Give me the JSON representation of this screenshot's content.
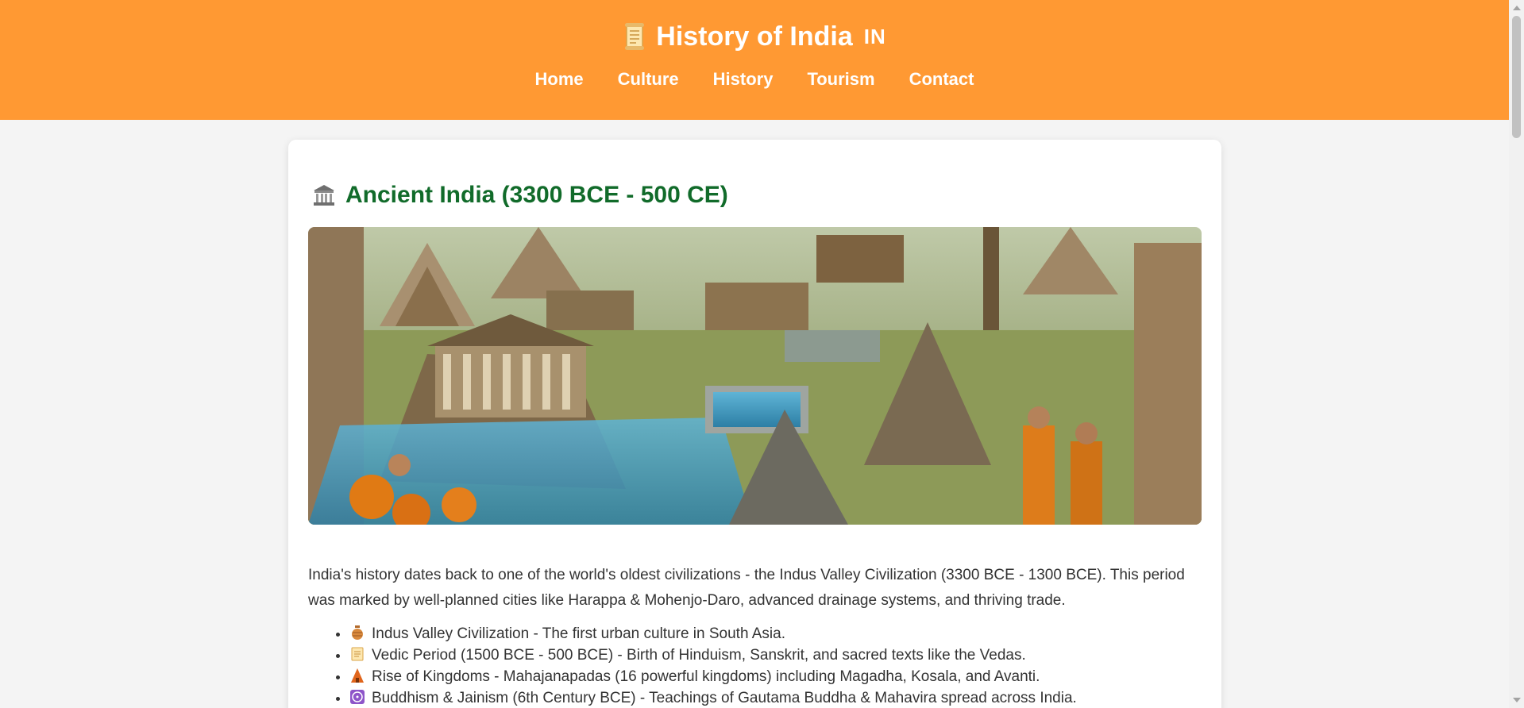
{
  "header": {
    "title": "History of India",
    "flag_code": "IN",
    "icons": {
      "title": "scroll-icon"
    },
    "brand_color": "#ff9933",
    "nav": [
      {
        "label": "Home"
      },
      {
        "label": "Culture"
      },
      {
        "label": "History"
      },
      {
        "label": "Tourism"
      },
      {
        "label": "Contact"
      }
    ]
  },
  "main": {
    "section_title": "Ancient India (3300 BCE - 500 CE)",
    "section_icon": "classical-building-icon",
    "title_color": "#116b2a",
    "hero_image": "ancient-india-illustration",
    "intro": "India's history dates back to one of the world's oldest civilizations - the Indus Valley Civilization (3300 BCE - 1300 BCE). This period was marked by well-planned cities like Harappa & Mohenjo-Daro, advanced drainage systems, and thriving trade.",
    "events": [
      {
        "icon": "amphora-icon",
        "text": "Indus Valley Civilization - The first urban culture in South Asia."
      },
      {
        "icon": "scroll-icon",
        "text": "Vedic Period (1500 BCE - 500 BCE) - Birth of Hinduism, Sanskrit, and sacred texts like the Vedas."
      },
      {
        "icon": "temple-icon",
        "text": "Rise of Kingdoms - Mahajanapadas (16 powerful kingdoms) including Magadha, Kosala, and Avanti."
      },
      {
        "icon": "dharma-wheel-icon",
        "text": "Buddhism & Jainism (6th Century BCE) - Teachings of Gautama Buddha & Mahavira spread across India."
      }
    ]
  }
}
